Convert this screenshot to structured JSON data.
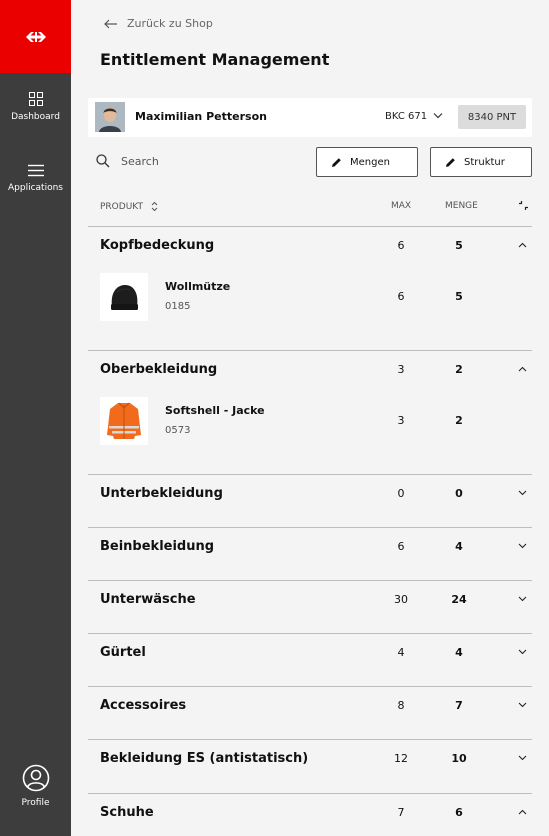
{
  "sidebar": {
    "logo": "sbb-logo-icon",
    "items": [
      {
        "label": "Dashboard",
        "icon": "dashboard-icon"
      },
      {
        "label": "Applications",
        "icon": "menu-icon"
      }
    ],
    "profile": {
      "label": "Profile",
      "icon": "profile-icon"
    }
  },
  "header": {
    "back_label": "Zurück zu Shop",
    "title": "Entitlement Management"
  },
  "user": {
    "name": "Maximilian Petterson",
    "bkc": "BKC 671",
    "points": "8340 PNT"
  },
  "toolbar": {
    "search_placeholder": "Search",
    "mengen_label": "Mengen",
    "struktur_label": "Struktur"
  },
  "table": {
    "col_product": "PRODUKT",
    "col_max": "MAX",
    "col_menge": "MENGE"
  },
  "categories": [
    {
      "name": "Kopfbedeckung",
      "max": "6",
      "menge": "5",
      "expanded": true,
      "products": [
        {
          "name": "Wollmütze",
          "code": "0185",
          "max": "6",
          "menge": "5",
          "image": "black-beanie"
        }
      ]
    },
    {
      "name": "Oberbekleidung",
      "max": "3",
      "menge": "2",
      "expanded": true,
      "products": [
        {
          "name": "Softshell - Jacke",
          "code": "0573",
          "max": "3",
          "menge": "2",
          "image": "orange-hi-vis-jacket"
        }
      ]
    },
    {
      "name": "Unterbekleidung",
      "max": "0",
      "menge": "0",
      "expanded": false
    },
    {
      "name": "Beinbekleidung",
      "max": "6",
      "menge": "4",
      "expanded": false
    },
    {
      "name": "Unterwäsche",
      "max": "30",
      "menge": "24",
      "expanded": false
    },
    {
      "name": "Gürtel",
      "max": "4",
      "menge": "4",
      "expanded": false
    },
    {
      "name": "Accessoires",
      "max": "8",
      "menge": "7",
      "expanded": false
    },
    {
      "name": "Bekleidung ES (antistatisch)",
      "max": "12",
      "menge": "10",
      "expanded": false
    },
    {
      "name": "Schuhe",
      "max": "7",
      "menge": "6",
      "expanded": true
    }
  ],
  "colors": {
    "brand_red": "#eb0000",
    "sidebar": "#3d3d3d",
    "jacket_orange": "#f26b1d"
  }
}
